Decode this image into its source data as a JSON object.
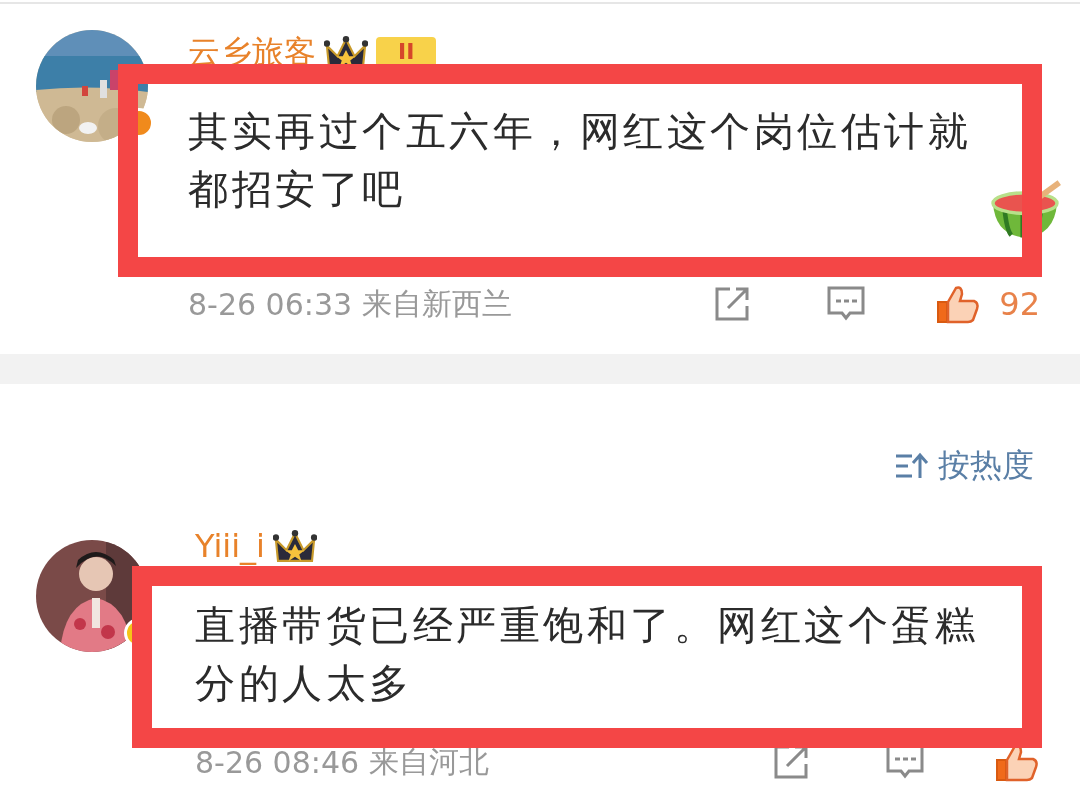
{
  "comments": [
    {
      "username": "云乡旅客",
      "badge": {
        "color": "#f08a1c"
      },
      "level_tag": "II",
      "highlighted": true,
      "hot_emoji": true,
      "text": "其实再过个五六年，网红这个岗位估计就都招安了吧",
      "time": "8-26 06:33",
      "location": "来自新西兰",
      "likes": "92"
    },
    {
      "username": "Yiii_i",
      "badge": {
        "color": "#f5c518"
      },
      "highlighted": true,
      "text": "直播带货已经严重饱和了。网红这个蛋糕分的人太多",
      "time": "8-26 08:46",
      "location": "来自河北"
    }
  ],
  "sort": {
    "label": "按热度"
  }
}
